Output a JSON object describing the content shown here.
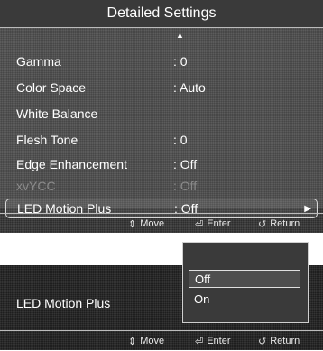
{
  "menu": {
    "title": "Detailed Settings",
    "up_arrow": "▲",
    "items": [
      {
        "label": "Gamma",
        "value": ": 0"
      },
      {
        "label": "Color Space",
        "value": ": Auto"
      },
      {
        "label": "White Balance",
        "value": ""
      },
      {
        "label": "Flesh Tone",
        "value": ": 0"
      },
      {
        "label": "Edge Enhancement",
        "value": ": Off"
      },
      {
        "label": "xvYCC",
        "value": ": Off"
      },
      {
        "label": "LED Motion Plus",
        "value": ": Off"
      }
    ],
    "selected_arrow": "▶"
  },
  "footer": {
    "move_label": "Move",
    "enter_label": "Enter",
    "return_label": "Return",
    "move_icon": "⇕",
    "enter_icon": "⏎",
    "return_icon": "↺"
  },
  "popup": {
    "item_label": "LED Motion Plus",
    "options": [
      "Off",
      "On"
    ]
  },
  "colors": {
    "panel_bg": "#2e2e2e",
    "disabled_text": "#8a8a8a",
    "selection_border": "#d8d8d8"
  }
}
